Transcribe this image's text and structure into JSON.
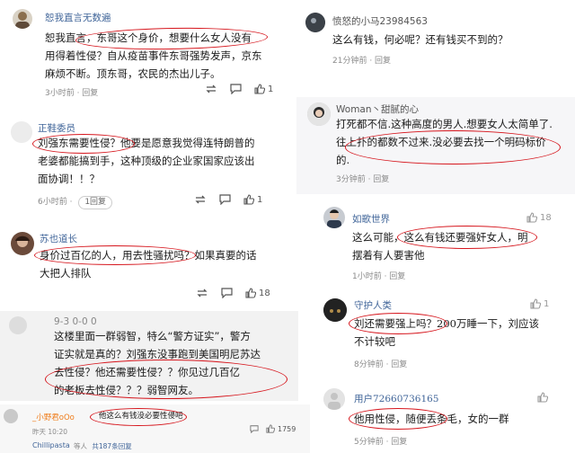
{
  "comments": [
    {
      "name": "恕我直言无数遍",
      "lines": [
        "恕我直言，东哥这个身价，想要什么女人没有",
        "用得着性侵？自从疫苗事件东哥强势发声，京东",
        "麻烦不断。顶东哥，农民的杰出儿子。"
      ],
      "time": "3小时前 · 回复",
      "likes": "1"
    },
    {
      "name": "正鞋委员",
      "lines": [
        "刘强东需要性侵？他要是愿意我觉得连特朗普的",
        "老婆都能搞到手，这种顶级的企业家国家应该出",
        "面协调！！？"
      ],
      "time": "6小时前 ·",
      "reply_pill": "1回复",
      "likes": "1"
    },
    {
      "name": "苏也道长",
      "lines": [
        "身价过百亿的人，用去性骚扰吗？如果真要的话",
        "大把人排队"
      ],
      "time": "",
      "likes": "18"
    },
    {
      "name": "9-3 0-0 0",
      "lines": [
        "这楼里面一群弱智，特么“警方证实”，警方",
        "证实就是真的？刘强东没事跑到美国明尼苏达",
        "去性侵？他还需要性侵？？你见过几百亿",
        "的老板去性侵？？？弱智网友。"
      ],
      "time": "",
      "likes": ""
    },
    {
      "name": "_小野君oOo",
      "lines": [
        "他这么有钱没必要性侵吧"
      ],
      "time": "昨天 10:20",
      "likes": "1759"
    },
    {
      "name": "Chillipasta",
      "lines": [],
      "time": "等人",
      "reply_pill": "共187条回复",
      "likes": ""
    },
    {
      "name": "愤怒的小马23984563",
      "lines": [
        "这么有钱，何必呢？还有钱买不到的？"
      ],
      "time": "21分钟前 · 回复",
      "likes": ""
    },
    {
      "name": "Woman丶甜腻的心",
      "lines": [
        "打死都不信.这种高度的男人.想要女人太简单了.",
        "往上扑的都数不过来.没必要去找一个明码标价",
        "的."
      ],
      "time": "3分钟前 · 回复",
      "likes": ""
    },
    {
      "name": "如歌世界",
      "lines": [
        "这么可能，这么有钱还要强奸女人，明",
        "摆着有人要害他"
      ],
      "time": "1小时前 · 回复",
      "likes": "18"
    },
    {
      "name": "守护人类",
      "lines": [
        "刘还需要强上吗？200万睡一下，刘应该",
        "不计较吧"
      ],
      "time": "8分钟前 · 回复",
      "likes": "1"
    },
    {
      "name": "用户72660736165",
      "lines": [
        "他用性侵，随便丢条毛，女的一群"
      ],
      "time": "5分钟前 · 回复",
      "likes": ""
    }
  ],
  "colors": {
    "name": "#406599",
    "highlight": "#d6161d",
    "text": "#1a1a1a",
    "meta": "#8a8a8a"
  },
  "icons": [
    "avatar",
    "repost-icon",
    "reply-icon",
    "like-icon"
  ]
}
